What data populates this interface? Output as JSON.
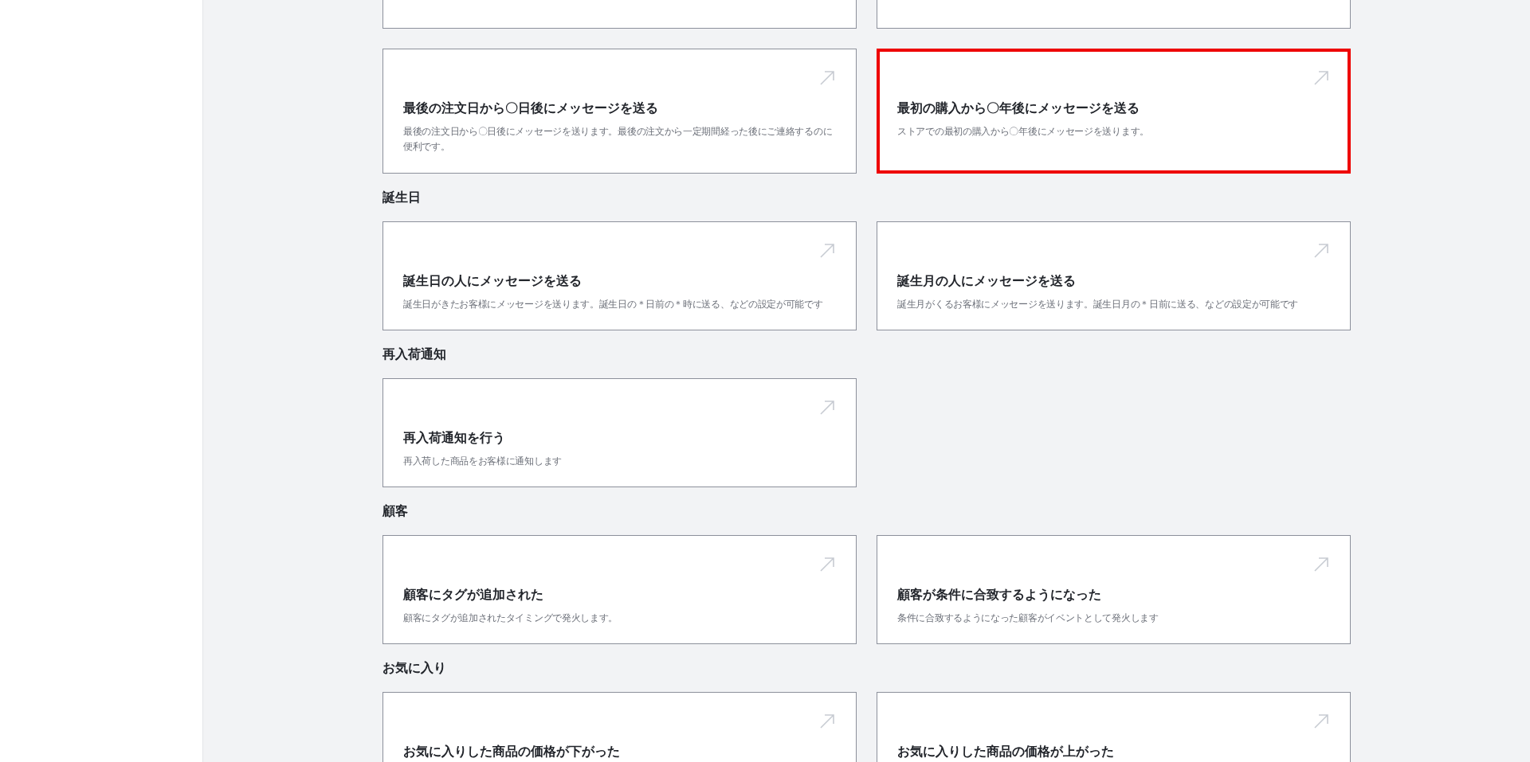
{
  "top_cut_cards": [
    {
      "kind": "card"
    },
    {
      "kind": "card"
    }
  ],
  "sections": [
    {
      "cards": [
        {
          "title": "最後の注文日から〇日後にメッセージを送る",
          "description": "最後の注文日から〇日後にメッセージを送ります。最後の注文から一定期間経った後にご連絡するのに便利です。",
          "highlighted": false
        },
        {
          "title": "最初の購入から〇年後にメッセージを送る",
          "description": "ストアでの最初の購入から〇年後にメッセージを送ります。",
          "highlighted": true
        }
      ]
    },
    {
      "heading": "誕生日",
      "cards": [
        {
          "title": "誕生日の人にメッセージを送る",
          "description": "誕生日がきたお客様にメッセージを送ります。誕生日の＊日前の＊時に送る、などの設定が可能です",
          "highlighted": false
        },
        {
          "title": "誕生月の人にメッセージを送る",
          "description": "誕生月がくるお客様にメッセージを送ります。誕生日月の＊日前に送る、などの設定が可能です",
          "highlighted": false
        }
      ]
    },
    {
      "heading": "再入荷通知",
      "cards": [
        {
          "title": "再入荷通知を行う",
          "description": "再入荷した商品をお客様に通知します",
          "highlighted": false
        }
      ]
    },
    {
      "heading": "顧客",
      "cards": [
        {
          "title": "顧客にタグが追加された",
          "description": "顧客にタグが追加されたタイミングで発火します。",
          "highlighted": false
        },
        {
          "title": "顧客が条件に合致するようになった",
          "description": "条件に合致するようになった顧客がイベントとして発火します",
          "highlighted": false
        }
      ]
    },
    {
      "heading": "お気に入り",
      "cards": [
        {
          "title": "お気に入りした商品の価格が下がった",
          "highlighted": false
        },
        {
          "title": "お気に入りした商品の価格が上がった",
          "highlighted": false
        }
      ]
    }
  ]
}
